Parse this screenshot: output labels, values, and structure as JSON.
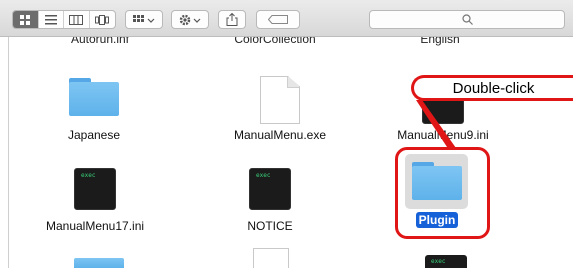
{
  "toolbar": {
    "view_modes": [
      "icon-view",
      "list-view",
      "column-view",
      "cover-flow-view"
    ],
    "arrange_icon": "grid-arrange-icon",
    "action_icon": "gear-icon",
    "share_icon": "share-icon",
    "tag_icon": "tag-icon",
    "search_icon": "search-icon"
  },
  "partial_top_labels": [
    "Autorun.inf",
    "ColorCollection",
    "English"
  ],
  "items": [
    {
      "label": "Japanese",
      "type": "folder"
    },
    {
      "label": "ManualMenu.exe",
      "type": "document"
    },
    {
      "label": "ManualMenu9.ini",
      "type": "exec"
    },
    {
      "label": "ManualMenu17.ini",
      "type": "exec",
      "icon_text": "exec"
    },
    {
      "label": "NOTICE",
      "type": "exec",
      "icon_text": "exec"
    },
    {
      "label": "Plugin",
      "type": "folder",
      "selected": true
    }
  ],
  "annotation": {
    "callout_text": "Double-click",
    "color": "#e01616"
  },
  "colors": {
    "selection": "#1660d8",
    "folder": "#6dbcef"
  },
  "exec_icon_text": "exec"
}
